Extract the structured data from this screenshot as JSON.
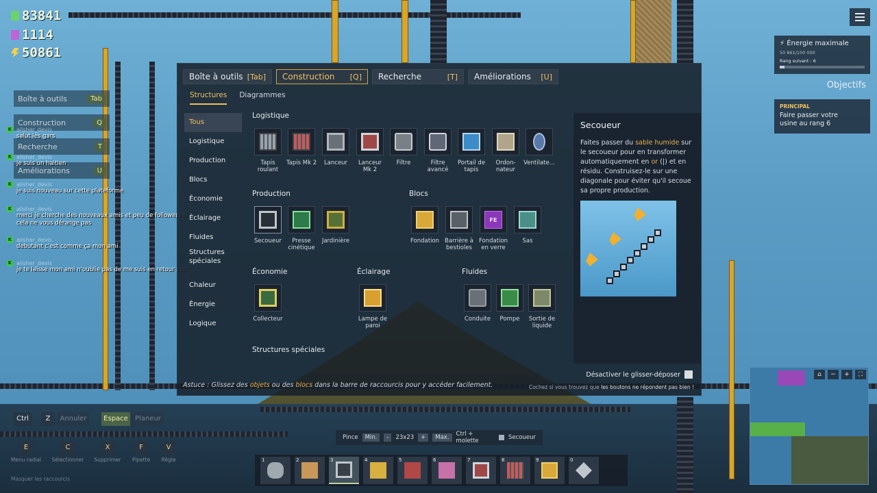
{
  "hud": {
    "money": "83841",
    "research": "1114",
    "energy": "50861"
  },
  "left_menu": [
    {
      "label": "Boîte à outils",
      "key": "Tab"
    },
    {
      "label": "Construction",
      "key": "Q"
    },
    {
      "label": "Recherche",
      "key": "T"
    },
    {
      "label": "Améliorations",
      "key": "U"
    }
  ],
  "chat": [
    {
      "who": "alisher_devis",
      "text": "salut les gars"
    },
    {
      "who": "alisher_devis",
      "text": "je suis un haitien"
    },
    {
      "who": "alisher_devis",
      "text": "je suis nouveau sur cette plateforme"
    },
    {
      "who": "alisher_devis",
      "text": "merci je cherche des nouveaux amis et peu de followers si cela ne vous dérange pas"
    },
    {
      "who": "alisher_devis",
      "text": "debutant c'est comme ça mon ami"
    },
    {
      "who": "alisher_devis",
      "text": "je te laisse mon ami n'oublie pas de me suis en retour svp"
    }
  ],
  "panel": {
    "tabs": [
      {
        "label": "Boîte à outils",
        "key": "[Tab]"
      },
      {
        "label": "Construction",
        "key": "[Q]"
      },
      {
        "label": "Recherche",
        "key": "[T]"
      },
      {
        "label": "Améliorations",
        "key": "[U]"
      }
    ],
    "subtabs": [
      "Structures",
      "Diagrammes"
    ],
    "categories": [
      "Tous",
      "Logistique",
      "Production",
      "Blocs",
      "Économie",
      "Éclairage",
      "Fluides",
      "Structures spéciales",
      "Chaleur",
      "Énergie",
      "Logique"
    ],
    "sections": {
      "logistics": "Logistique",
      "production": "Production",
      "blocks": "Blocs",
      "economy": "Économie",
      "lighting": "Éclairage",
      "fluids": "Fluides",
      "special": "Structures spéciales"
    },
    "items": {
      "conveyor": "Tapis roulant",
      "conveyor2": "Tapis Mk 2",
      "launcher": "Lanceur",
      "launcher2": "Lanceur Mk 2",
      "filter": "Filtre",
      "filter2": "Filtre avancé",
      "portal": "Portail de tapis",
      "orderer": "Ordon- nateur",
      "vent": "Ventilate...",
      "shaker": "Secoueur",
      "press": "Presse cinétique",
      "garden": "Jardinière",
      "foundation": "Fondation",
      "barrier": "Barrière à bestioles",
      "glass": "Fondation en verre",
      "glass_icon": "FE",
      "airlock": "Sas",
      "collector": "Collecteur",
      "lamp": "Lampe de paroi",
      "pipe": "Conduite",
      "pump": "Pompe",
      "outlet": "Sortie de liquide"
    },
    "desc": {
      "title": "Secoueur",
      "t1": "Faites passer du ",
      "h1": "sable humide",
      "t2": " sur le secoueur pour en transformer automatiquement en ",
      "h2": "or",
      "t3": " (|) et en résidu. Construisez-le sur une diagonale pour éviter qu'il secoue sa propre production."
    },
    "drag_label": "Désactiver le glisser-déposer",
    "tip": {
      "t1": "Astuce : Glissez des ",
      "h1": "objets",
      "t2": " ou des ",
      "h2": "blocs",
      "t3": " dans la barre de raccourcis pour y accéder facilement."
    },
    "btn_hint": {
      "t1": "Cochez si vous trouvez que ",
      "b": "les boutons ne répondent pas bien !"
    }
  },
  "right_hud": {
    "energy_title": "Énergie maximale",
    "energy_value": "50 861/100 000",
    "energy_next": "Rang suivant : 6",
    "energy_fill": 0.06,
    "objectives_title": "Objectifs",
    "obj_category": "PRINCIPAL",
    "obj_text": "Faire passer votre usine au rang 6"
  },
  "bottom": {
    "ctrl": "Ctrl",
    "z": "Z",
    "undo": "Annuler",
    "space": "Espace",
    "planner": "Planeur",
    "keys": [
      {
        "k": "E",
        "l": "Menu radial"
      },
      {
        "k": "C",
        "l": "Sélectionner"
      },
      {
        "k": "X",
        "l": "Supprimer"
      },
      {
        "k": "F",
        "l": "Pipette"
      },
      {
        "k": "V",
        "l": "Règle"
      }
    ],
    "hide_hotkeys": "Masquer les raccourcis",
    "brush": {
      "pinch": "Pince",
      "min": "Min.",
      "minus": "-",
      "size": "23x23",
      "plus": "+",
      "max": "Max.",
      "wheel": "Ctrl + molette",
      "shaker": "Secoueur"
    },
    "hotbar": [
      "1",
      "2",
      "3",
      "4",
      "5",
      "6",
      "7",
      "8",
      "9",
      "0"
    ]
  },
  "colors": {
    "accent": "#f0c060",
    "highlight": "#e8b04a",
    "panel_bg": "#161e28"
  }
}
